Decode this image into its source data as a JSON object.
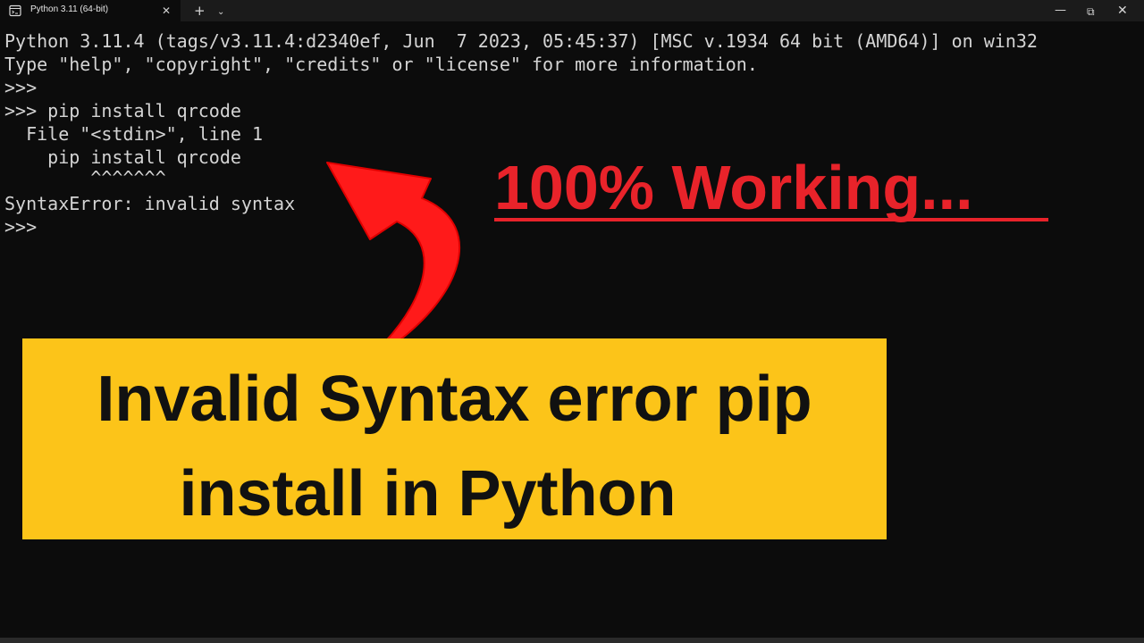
{
  "window": {
    "tab_title": "Python 3.11 (64-bit)",
    "tab_close": "✕",
    "new_tab": "+",
    "tab_dropdown": "⌄",
    "minimize": "—",
    "maximize": "⧉",
    "close": "✕",
    "icons": {
      "tab": "terminal-icon",
      "new_tab": "plus-icon",
      "dropdown": "chevron-down-icon"
    }
  },
  "terminal": {
    "lines": [
      "Python 3.11.4 (tags/v3.11.4:d2340ef, Jun  7 2023, 05:45:37) [MSC v.1934 64 bit (AMD64)] on win32",
      "Type \"help\", \"copyright\", \"credits\" or \"license\" for more information.",
      ">>>",
      ">>> pip install qrcode",
      "  File \"<stdin>\", line 1",
      "    pip install qrcode",
      "        ^^^^^^^",
      "SyntaxError: invalid syntax",
      ">>>"
    ],
    "text_color": "#d4d4d4",
    "background": "#0c0c0c"
  },
  "overlay": {
    "headline": "100% Working...",
    "headline_color": "#e8232a",
    "arrow_color": "#ff1a1a",
    "banner_line_1": "Invalid Syntax error pip",
    "banner_line_2": "install in Python",
    "banner_color": "#fcc419"
  }
}
